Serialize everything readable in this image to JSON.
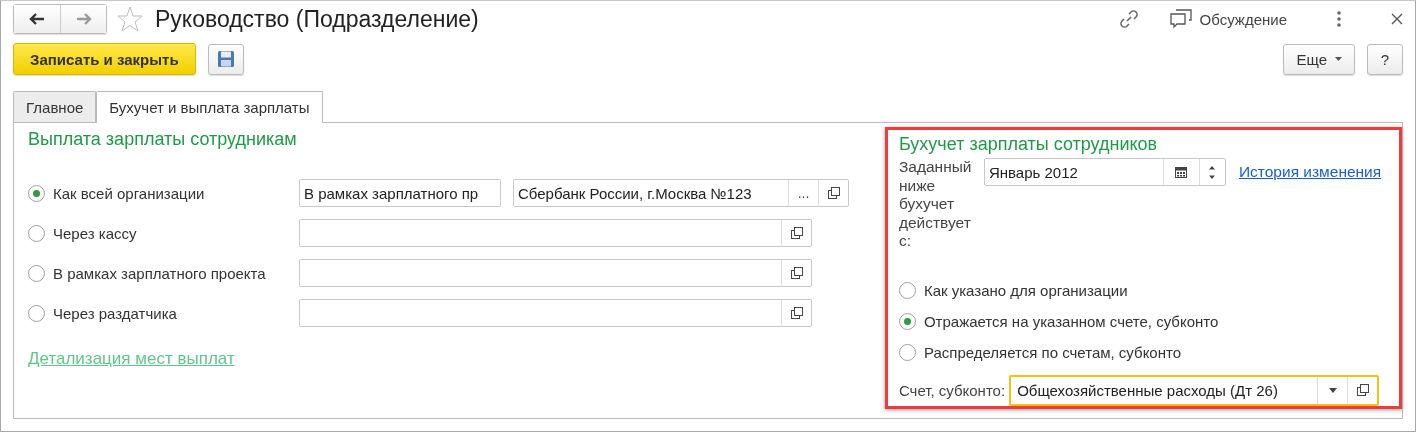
{
  "window": {
    "title": "Руководство (Подразделение)",
    "favorite": false,
    "discussion_label": "Обсуждение"
  },
  "toolbar": {
    "buttons": [
      {
        "kind": "primary",
        "label": "Записать и закрыть"
      },
      {
        "kind": "save"
      },
      {
        "kind": "menu",
        "label": "Еще"
      },
      {
        "kind": "help",
        "label": "?"
      }
    ]
  },
  "tabs": [
    {
      "label": "Главное",
      "selected": false
    },
    {
      "label": "Бухучет и выплата зарплаты",
      "selected": true
    }
  ],
  "payment": {
    "title": "Выплата зарплаты сотрудникам",
    "options": [
      {
        "label": "Как всей организации",
        "selected": true,
        "fields": [
          {
            "kind": "plain",
            "value": "В рамках зарплатного пр"
          },
          {
            "kind": "choice",
            "value": "Сбербанк России, г.Москва №123",
            "button": "..."
          }
        ]
      },
      {
        "label": "Через кассу",
        "selected": false,
        "fields": [
          {
            "kind": "open"
          }
        ]
      },
      {
        "label": "В рамках зарплатного проекта",
        "selected": false,
        "fields": [
          {
            "kind": "open"
          }
        ]
      },
      {
        "label": "Через раздатчика",
        "selected": false,
        "fields": [
          {
            "kind": "open"
          }
        ]
      }
    ],
    "link": "Детализация мест выплат"
  },
  "accounting": {
    "title": "Бухучет зарплаты сотрудников",
    "highlighted": true,
    "period_label": "Заданный ниже бухучет действует с:",
    "period_value": "Январь 2012",
    "history_link": "История изменения",
    "options": [
      {
        "label": "Как указано для организации",
        "selected": false
      },
      {
        "label": "Отражается на указанном счете, субконто",
        "selected": true
      },
      {
        "label": "Распределяется по счетам, субконто",
        "selected": false
      }
    ],
    "account_label": "Счет, субконто:",
    "account_value": "Общехозяйственные расходы (Дт 26)",
    "account_focused": true
  }
}
